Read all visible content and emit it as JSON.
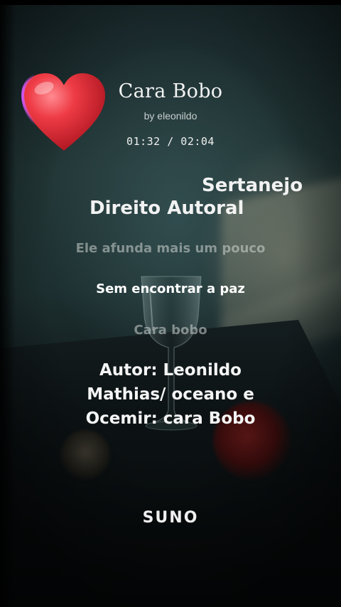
{
  "song": {
    "title": "Cara Bobo",
    "artist_line": "by eleonildo",
    "time_display": "01:32 / 02:04"
  },
  "tags": {
    "genre": "Sertanejo",
    "copyright": "Direito Autoral"
  },
  "lyrics": {
    "previous": "Ele afunda mais um pouco",
    "current": "Sem encontrar a paz",
    "next": "Cara bobo"
  },
  "author_note": "Autor: Leonildo Mathias/ oceano e Ocemir: cara Bobo",
  "watermark": "SUNO",
  "icons": {
    "heart": "heart-icon"
  },
  "colors": {
    "heart": "#e8323c",
    "text": "#f2f2f2",
    "background": "#1d2f30"
  }
}
